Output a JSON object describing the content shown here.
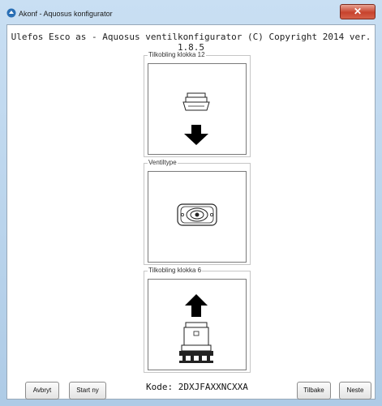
{
  "window": {
    "title": "Akonf - Aquosus konfigurator",
    "close_label": "✕"
  },
  "header": {
    "text": "Ulefos Esco as - Aquosus ventilkonfigurator (C) Copyright 2014 ver. 1.8.5"
  },
  "panels": [
    {
      "title": "Tilkobling klokka 12"
    },
    {
      "title": "Ventiltype"
    },
    {
      "title": "Tilkobling klokka 6"
    }
  ],
  "buttons": {
    "cancel": "Avbryt",
    "restart": "Start ny",
    "back": "Tilbake",
    "next": "Neste"
  },
  "code": {
    "text": "Kode: 2DXJFAXXNCXXA"
  },
  "colors": {
    "window_frame": "#b9d3ec",
    "close_button": "#c7422d"
  }
}
